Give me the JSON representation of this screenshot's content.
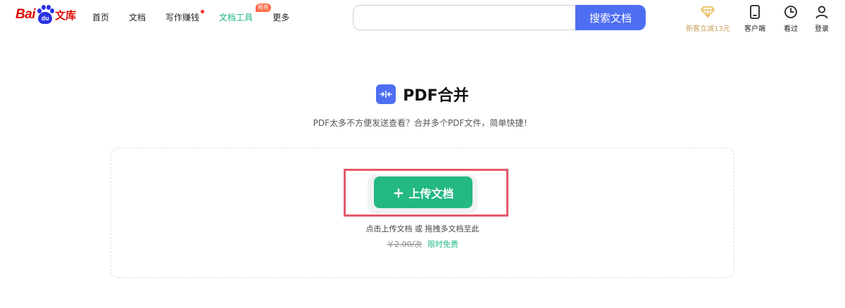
{
  "logo": {
    "bai": "Bai",
    "du": "du",
    "wenku": "文库"
  },
  "nav": {
    "items": [
      {
        "label": "首页"
      },
      {
        "label": "文档"
      },
      {
        "label": "写作赚钱"
      },
      {
        "label": "文档工具",
        "badge": "限免"
      },
      {
        "label": "更多"
      }
    ]
  },
  "search": {
    "value": "",
    "placeholder": "",
    "button_label": "搜索文档"
  },
  "header_right": {
    "promo_label": "新客立减13元",
    "client_label": "客户端",
    "history_label": "看过",
    "login_label": "登录"
  },
  "main": {
    "title": "PDF合并",
    "subtitle": "PDF太多不方便发送查看？合并多个PDF文件，简单快捷！",
    "upload_label": "上传文档",
    "hint": "点击上传文档 或 拖拽多文档至此",
    "price_old": "￥2.00/次",
    "price_free": "限时免费"
  },
  "colors": {
    "brand_red": "#e10602",
    "brand_blue": "#4e6ef2",
    "accent_green": "#24b883",
    "highlight_red": "#e35a6a",
    "promo_gold": "#c8a15a"
  },
  "icons": {
    "promo": "diamond-icon",
    "client": "tablet-icon",
    "history": "clock-icon",
    "login": "user-icon",
    "title": "merge-icon"
  }
}
